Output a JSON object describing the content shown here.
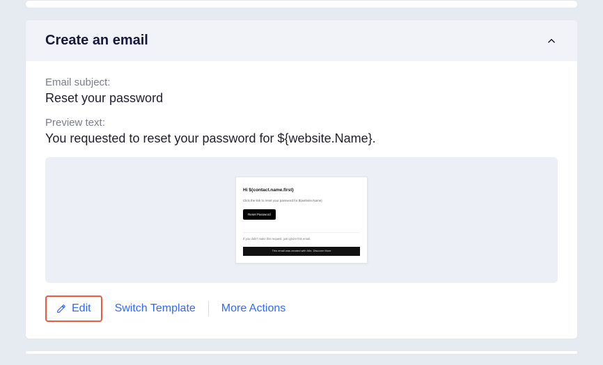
{
  "section": {
    "title": "Create an email"
  },
  "fields": {
    "subject_label": "Email subject:",
    "subject_value": "Reset your password",
    "preview_label": "Preview text:",
    "preview_value": "You requested to reset your password for ${website.Name}."
  },
  "thumbnail": {
    "greeting": "Hi ${contact.name.first}",
    "line1": "Click the link to reset your password for ${website.Name}",
    "button": "Reset Password",
    "note": "If you didn't make this request, just ignore this email.",
    "footer": "This email was created with Wix.  Discover More"
  },
  "actions": {
    "edit": "Edit",
    "switch": "Switch Template",
    "more": "More Actions"
  }
}
